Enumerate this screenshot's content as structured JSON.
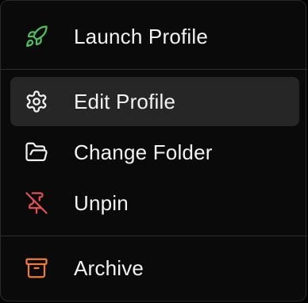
{
  "menu": {
    "items": [
      {
        "label": "Launch Profile",
        "icon": "rocket-icon",
        "color": "#4fbf5f"
      },
      {
        "label": "Edit Profile",
        "icon": "gear-icon",
        "color": "#f2f2f2",
        "highlighted": true
      },
      {
        "label": "Change Folder",
        "icon": "folder-open-icon",
        "color": "#f2f2f2"
      },
      {
        "label": "Unpin",
        "icon": "pin-off-icon",
        "color": "#e05252"
      },
      {
        "label": "Archive",
        "icon": "archive-icon",
        "color": "#f07a3a"
      }
    ]
  }
}
